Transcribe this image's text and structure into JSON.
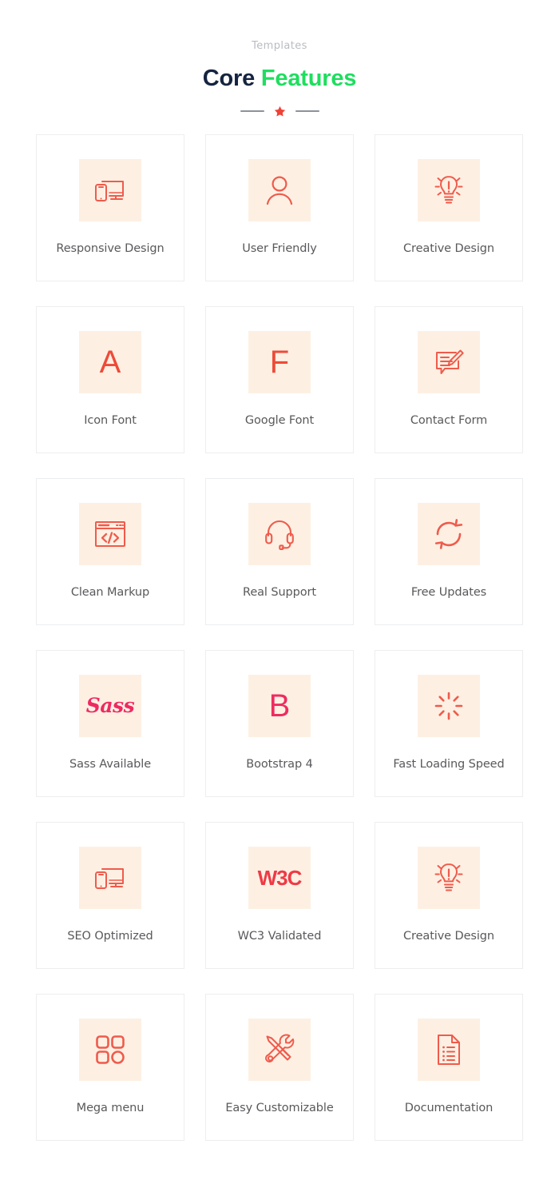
{
  "header": {
    "subtitle": "Templates",
    "title_part1": "Core",
    "title_part2": "Features",
    "divider_icon": "star-icon"
  },
  "colors": {
    "title_dark": "#152440",
    "title_accent": "#1ede5f",
    "subtitle": "#b9bcc2",
    "icon_stroke": "#ef5b4c",
    "icon_box_bg": "#fdf0e3",
    "card_border": "#eceef0",
    "label_text": "#59595c",
    "divider_bar": "#8d9199",
    "star": "#ef4136",
    "bootstrap_b": "#ee2c5f",
    "sass_script": "#ee2a62",
    "w3c": "#ef3a45"
  },
  "grid": {
    "columns": 3,
    "cards": [
      {
        "label": "Responsive Design",
        "icon": "devices-responsive-icon"
      },
      {
        "label": "User Friendly",
        "icon": "user-person-icon"
      },
      {
        "label": "Creative Design",
        "icon": "lightbulb-idea-icon"
      },
      {
        "label": "Icon Font",
        "icon": "letter-a-icon"
      },
      {
        "label": "Google Font",
        "icon": "letter-f-icon"
      },
      {
        "label": "Contact Form",
        "icon": "form-pencil-icon"
      },
      {
        "label": "Clean Markup",
        "icon": "code-browser-icon"
      },
      {
        "label": "Real Support",
        "icon": "headset-icon"
      },
      {
        "label": "Free Updates",
        "icon": "refresh-sync-icon"
      },
      {
        "label": "Sass Available",
        "icon": "sass-logo-icon"
      },
      {
        "label": "Bootstrap 4",
        "icon": "letter-b-icon"
      },
      {
        "label": "Fast Loading Speed",
        "icon": "spinner-loading-icon"
      },
      {
        "label": "SEO Optimized",
        "icon": "devices-responsive-icon"
      },
      {
        "label": "WC3 Validated",
        "icon": "w3c-logo-icon"
      },
      {
        "label": "Creative Design",
        "icon": "lightbulb-idea-icon"
      },
      {
        "label": "Mega menu",
        "icon": "grid-blocks-icon"
      },
      {
        "label": "Easy Customizable",
        "icon": "tools-wrench-screwdriver-icon"
      },
      {
        "label": "Documentation",
        "icon": "document-list-icon"
      }
    ],
    "icon_glyphs": {
      "letter-a-icon": "A",
      "letter-f-icon": "F",
      "letter-b-icon": "B",
      "sass-logo-icon": "Sass",
      "w3c-logo-icon": "W3C"
    }
  }
}
